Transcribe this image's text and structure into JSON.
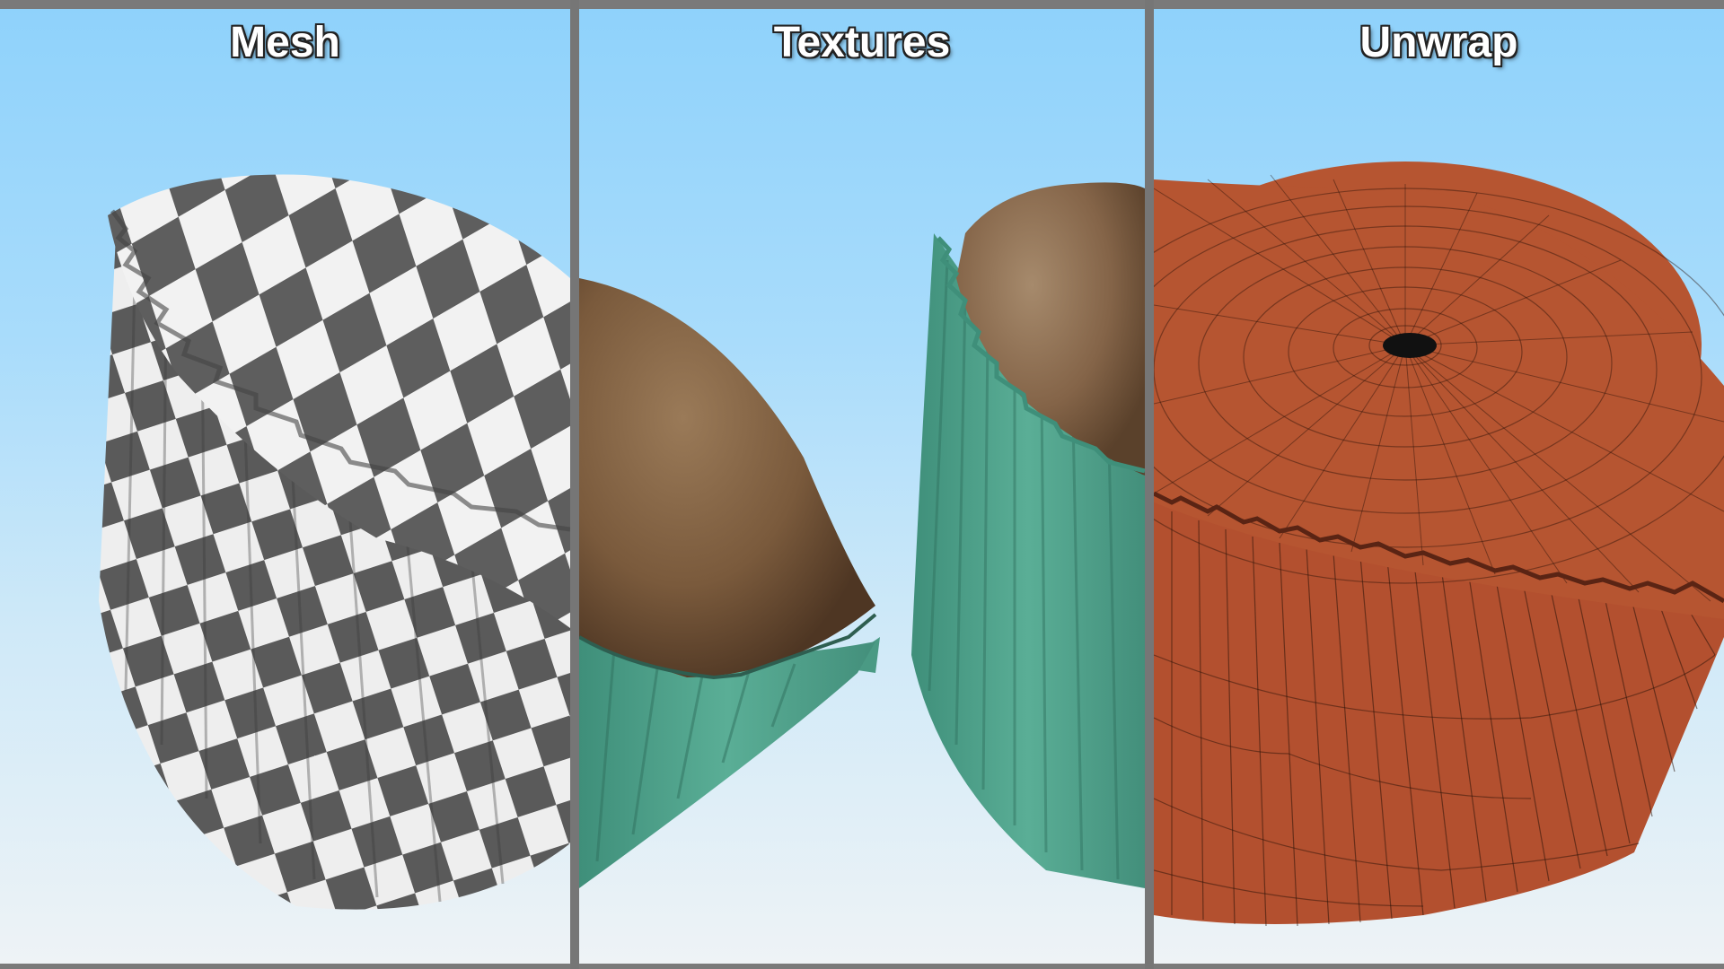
{
  "panels": [
    {
      "title": "Mesh",
      "icon": "cupcake-checker-render"
    },
    {
      "title": "Textures",
      "icon": "cupcake-textured-render"
    },
    {
      "title": "Unwrap",
      "icon": "cupcake-wireframe-render"
    }
  ],
  "colors": {
    "frame": "#767676",
    "sky_top": "#8fd2fb",
    "sky_bottom": "#eef3f6",
    "checker_dark": "#5e5e5e",
    "checker_light": "#f2f2f2",
    "sponge": "#8a6a4a",
    "liner": "#4fa08a",
    "unwrap": "#b3502f"
  }
}
